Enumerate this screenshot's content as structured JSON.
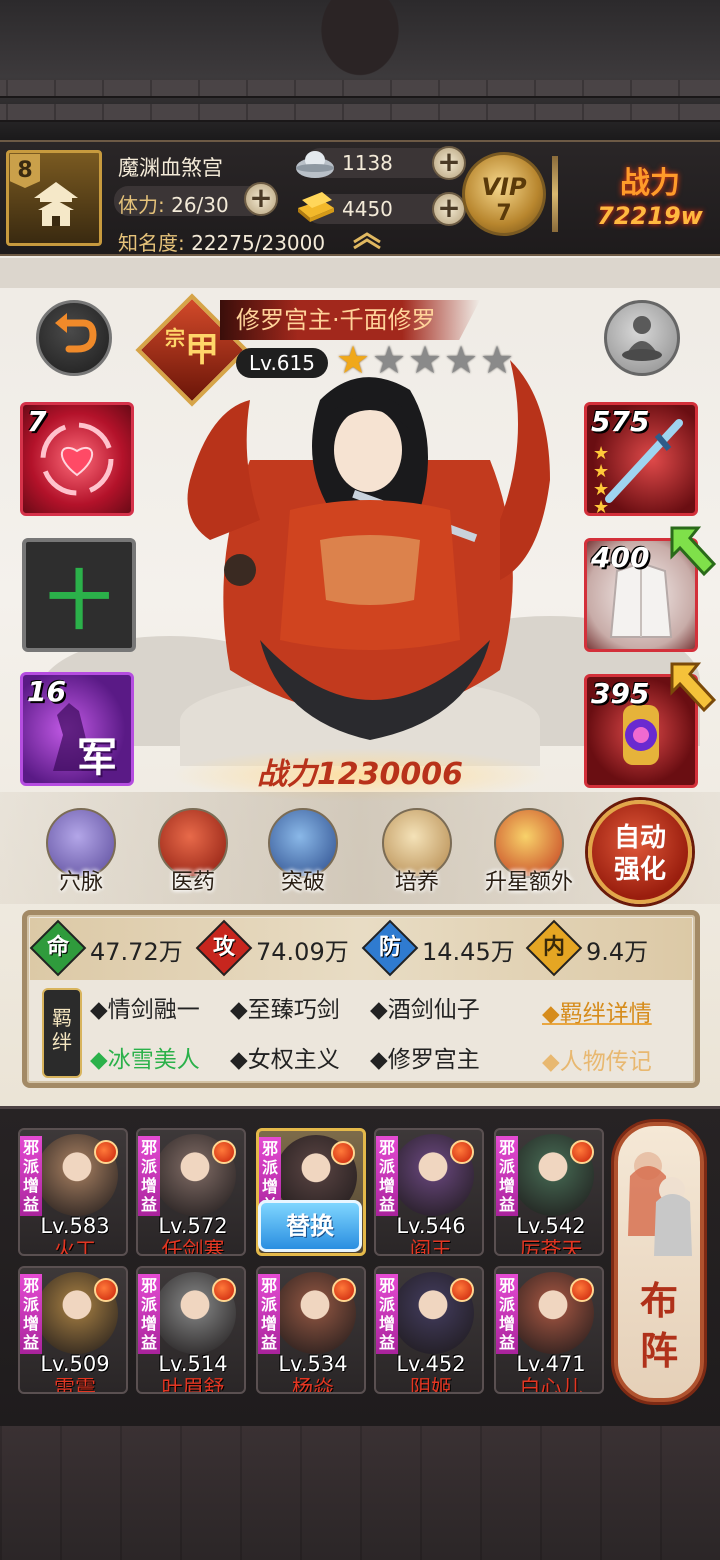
{
  "player": {
    "level": "8",
    "name": "魔渊血煞宫",
    "stamina_label": "体力:",
    "stamina_value": "26/30",
    "fame_label": "知名度:",
    "fame_value": "22275/23000",
    "silver": "1138",
    "gold": "4450",
    "vip_text": "VIP",
    "vip_level": "7",
    "power_label": "战力",
    "power_value": "72219w"
  },
  "hero": {
    "rank_char": "甲",
    "rank_prefix": "宗",
    "name": "修罗宫主·千面修罗",
    "level": "Lv.615",
    "stars_filled": 1,
    "stars_total": 5,
    "power": "战力1230006"
  },
  "left_slots": [
    {
      "count": "7"
    },
    {
      "symbol": "十"
    },
    {
      "count": "16",
      "glyph": "军"
    }
  ],
  "equipment": [
    {
      "count": "575",
      "icon": "sword-icon"
    },
    {
      "count": "400",
      "icon": "robe-icon"
    },
    {
      "count": "395",
      "icon": "treasure-icon"
    }
  ],
  "actions": [
    {
      "label": "穴脉",
      "icon": "meridian-icon"
    },
    {
      "label": "医药",
      "icon": "medicine-icon"
    },
    {
      "label": "突破",
      "icon": "breakthrough-icon"
    },
    {
      "label": "培养",
      "icon": "cultivate-icon"
    },
    {
      "label": "升星额外",
      "icon": "star-up-icon"
    }
  ],
  "auto_strengthen": {
    "line1": "自动",
    "line2": "强化"
  },
  "attributes": [
    {
      "char": "命",
      "value": "47.72万",
      "color": "#2f9b3c"
    },
    {
      "char": "攻",
      "value": "74.09万",
      "color": "#c7261e"
    },
    {
      "char": "防",
      "value": "14.45万",
      "color": "#2f7bd0"
    },
    {
      "char": "内",
      "value": "9.4万",
      "color": "#e5a623"
    }
  ],
  "bonds": {
    "badge_top": "羁",
    "badge_bottom": "绊",
    "tags": [
      {
        "text": "◆情剑融一",
        "active": false
      },
      {
        "text": "◆至臻巧剑",
        "active": false
      },
      {
        "text": "◆酒剑仙子",
        "active": false
      },
      {
        "text": "◆冰雪美人",
        "active": true
      },
      {
        "text": "◆女权主义",
        "active": false
      },
      {
        "text": "◆修罗宫主",
        "active": false
      }
    ],
    "detail_link": "◆羁绊详情",
    "bio_link": "◆人物传记"
  },
  "team": {
    "faction_tag": "邪派增益",
    "swap_label": "替换",
    "formation_line1": "布",
    "formation_line2": "阵",
    "cards": [
      {
        "level": "Lv.583",
        "name": "火工",
        "color": "#8a6a52"
      },
      {
        "level": "Lv.572",
        "name": "任剑寒",
        "color": "#6b5a55"
      },
      {
        "level": "",
        "name": "",
        "color": "#4d3b3a",
        "selected": true
      },
      {
        "level": "Lv.546",
        "name": "阎王",
        "color": "#5a3e6a"
      },
      {
        "level": "Lv.542",
        "name": "厉苍天",
        "color": "#3e5a48"
      },
      {
        "level": "Lv.509",
        "name": "雷震",
        "color": "#8a6a3a"
      },
      {
        "level": "Lv.514",
        "name": "叶眉舒",
        "color": "#707070"
      },
      {
        "level": "Lv.534",
        "name": "杨焱",
        "color": "#7a4a3a"
      },
      {
        "level": "Lv.452",
        "name": "阴姬",
        "color": "#3b3550"
      },
      {
        "level": "Lv.471",
        "name": "白心儿",
        "color": "#8a4a3a"
      }
    ]
  }
}
